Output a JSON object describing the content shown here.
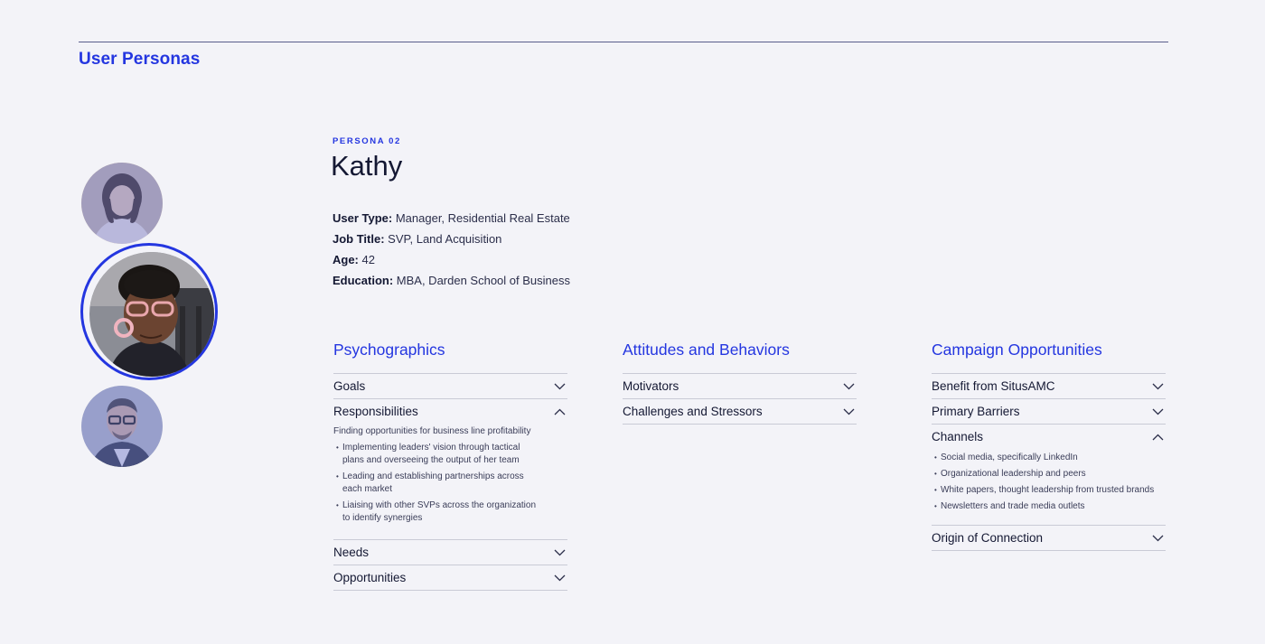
{
  "header": {
    "section_title": "User Personas"
  },
  "persona": {
    "label": "PERSONA 02",
    "name": "Kathy",
    "info": [
      {
        "key": "User Type:",
        "value": " Manager, Residential Real Estate"
      },
      {
        "key": "Job Title:",
        "value": " SVP, Land Acquisition"
      },
      {
        "key": "Age:",
        "value": " 42"
      },
      {
        "key": "Education:",
        "value": " MBA, Darden School of Business"
      }
    ]
  },
  "columns": [
    {
      "title": "Psychographics",
      "items": [
        {
          "label": "Goals",
          "expanded": false
        },
        {
          "label": "Responsibilities",
          "expanded": true,
          "lead": "Finding opportunities for business line profitability",
          "bullets": [
            "Implementing leaders' vision through tactical plans and overseeing the output of her team",
            "Leading and establishing partnerships across each market",
            "Liaising with other SVPs across the organization to identify synergies"
          ]
        },
        {
          "label": "Needs",
          "expanded": false
        },
        {
          "label": "Opportunities",
          "expanded": false
        }
      ]
    },
    {
      "title": "Attitudes and Behaviors",
      "items": [
        {
          "label": "Motivators",
          "expanded": false
        },
        {
          "label": "Challenges and Stressors",
          "expanded": false
        }
      ]
    },
    {
      "title": "Campaign Opportunities",
      "items": [
        {
          "label": "Benefit from SitusAMC",
          "expanded": false
        },
        {
          "label": "Primary Barriers",
          "expanded": false
        },
        {
          "label": "Channels",
          "expanded": true,
          "bullets": [
            "Social media, specifically LinkedIn",
            "Organizational leadership and peers",
            "White papers, thought leadership from trusted brands",
            "Newsletters and trade media outlets"
          ]
        },
        {
          "label": "Origin of Connection",
          "expanded": false
        }
      ]
    }
  ],
  "colors": {
    "accent": "#2436e0",
    "background": "#f3f3f8",
    "text": "#141833"
  },
  "icons": {
    "collapsed": "chevron-down-icon",
    "expanded": "chevron-up-icon"
  }
}
